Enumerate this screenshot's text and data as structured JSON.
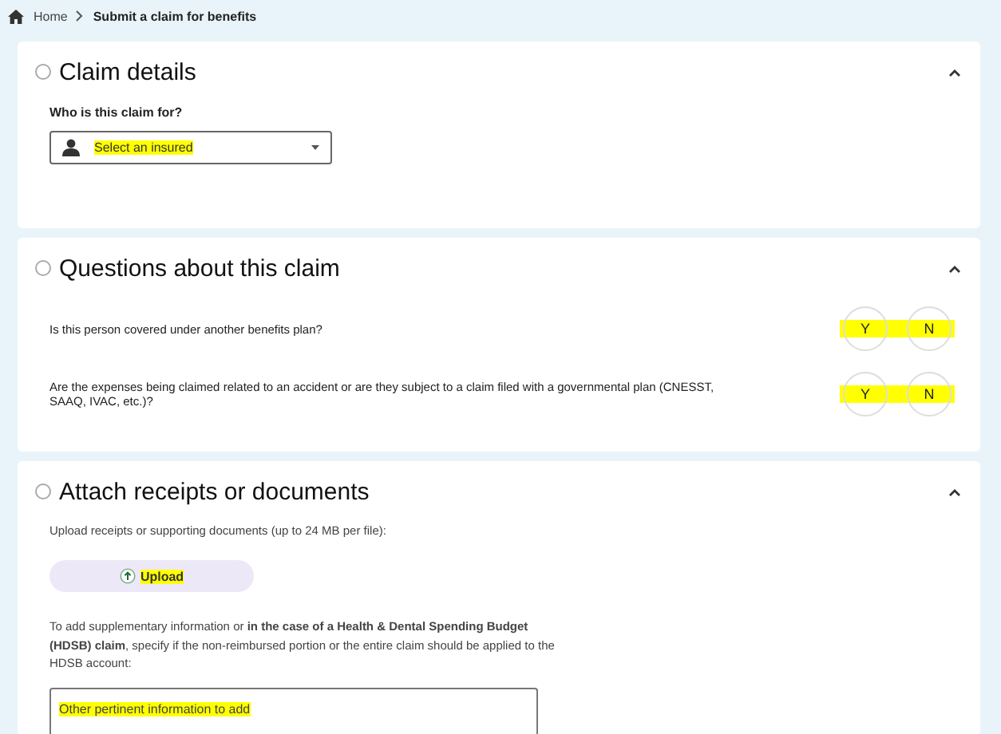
{
  "breadcrumb": {
    "items": [
      {
        "label": "Home",
        "kind": "home"
      },
      {
        "label": "Submit a claim for benefits",
        "kind": "current"
      }
    ]
  },
  "sections": [
    {
      "title": "Claim details",
      "expanded": true,
      "kind": "select",
      "field_label": "Who is this claim for?",
      "select": {
        "placeholder": "Select an insured",
        "highlighted": true
      }
    },
    {
      "title": "Questions about this claim",
      "expanded": true,
      "kind": "questions",
      "questions": [
        {
          "text": "Is this person covered under another benefits plan?",
          "answers": [
            "Y",
            "N"
          ],
          "highlighted": true
        },
        {
          "text": "Are the expenses being claimed related to an accident or are they subject to a claim filed with a governmental plan (CNESST, SAAQ, IVAC, etc.)?",
          "answers": [
            "Y",
            "N"
          ],
          "highlighted": true
        }
      ]
    },
    {
      "title": "Attach receipts or documents",
      "expanded": true,
      "kind": "attach",
      "upload_label": "Upload receipts or supporting documents (up to 24 MB per file):",
      "upload_button": {
        "label": "Upload",
        "highlighted": true
      },
      "info_text": "To add supplementary information or **in the case of a Health & Dental Spending Budget (HDSB) claim**, specify if the non-reimbursed portion or the entire claim should be applied to the HDSB account:",
      "info_field": {
        "placeholder": "Other pertinent information to add",
        "highlighted": true
      }
    }
  ]
}
